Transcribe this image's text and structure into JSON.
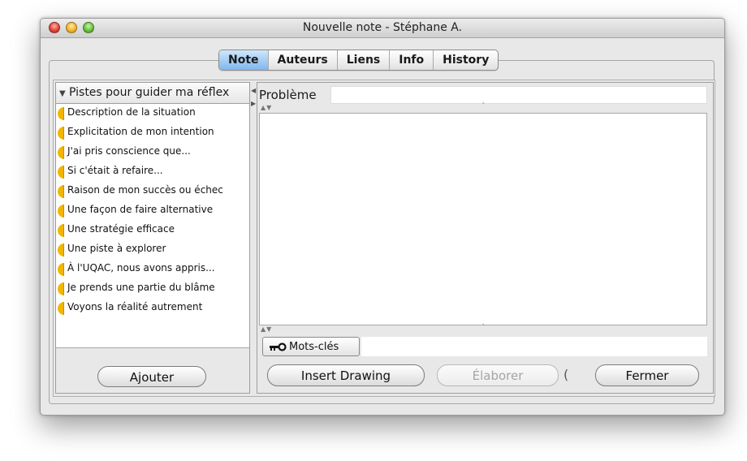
{
  "window": {
    "title": "Nouvelle note - Stéphane A."
  },
  "tabs": [
    {
      "label": "Note",
      "active": true
    },
    {
      "label": "Auteurs",
      "active": false
    },
    {
      "label": "Liens",
      "active": false
    },
    {
      "label": "Info",
      "active": false
    },
    {
      "label": "History",
      "active": false
    }
  ],
  "sidebar": {
    "header": "Pistes pour guider ma réflex",
    "items": [
      "Description de la situation",
      "Explicitation de mon intention",
      "J'ai pris conscience que...",
      "Si c'était à refaire...",
      "Raison de mon succès ou échec",
      "Une façon de faire alternative",
      "Une stratégie efficace",
      "Une piste à explorer",
      "À l'UQAC, nous avons appris...",
      "Je prends une partie du blâme",
      "Voyons la réalité autrement"
    ],
    "add_button": "Ajouter"
  },
  "editor": {
    "problem_label": "Problème",
    "problem_value": "",
    "body_text": "",
    "keywords_button": "Mots-clés",
    "keywords_value": ""
  },
  "actions": {
    "insert_drawing": "Insert Drawing",
    "elaborer": "Élaborer",
    "paren": "(",
    "fermer": "Fermer"
  },
  "colors": {
    "active_tab": "#7fb7ee",
    "bulb": "#f2b600",
    "close_light": "#e0473a",
    "minimize_light": "#f2b531",
    "zoom_light": "#6cc141"
  },
  "icons": {
    "sidebar_toggle": "triangle-down-icon",
    "item_marker": "half-circle-icon",
    "keywords": "key-icon"
  }
}
